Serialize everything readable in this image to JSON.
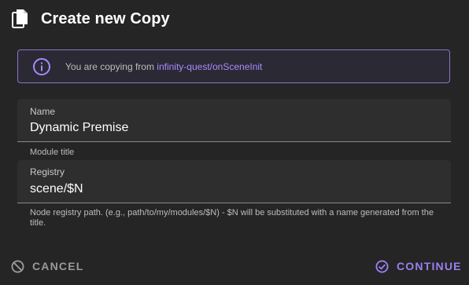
{
  "dialog": {
    "title": "Create new Copy",
    "title_icon": "copy-document-icon"
  },
  "info": {
    "icon": "info-circle-icon",
    "prefix": "You are copying from ",
    "source": "infinity-quest/onSceneInit"
  },
  "fields": {
    "name": {
      "label": "Name",
      "value": "Dynamic Premise",
      "helper": "Module title"
    },
    "registry": {
      "label": "Registry",
      "value": "scene/$N",
      "helper": "Node registry path. (e.g., path/to/my/modules/$N) - $N will be substituted with a name generated from the title."
    }
  },
  "actions": {
    "cancel": {
      "label": "CANCEL",
      "icon": "cancel-circle-slash-icon"
    },
    "continue": {
      "label": "CONTINUE",
      "icon": "check-circle-icon"
    }
  },
  "colors": {
    "background": "#252525",
    "accent": "#a68cff",
    "field_background": "#2e2e2e",
    "muted_text": "#bdbdbd"
  }
}
